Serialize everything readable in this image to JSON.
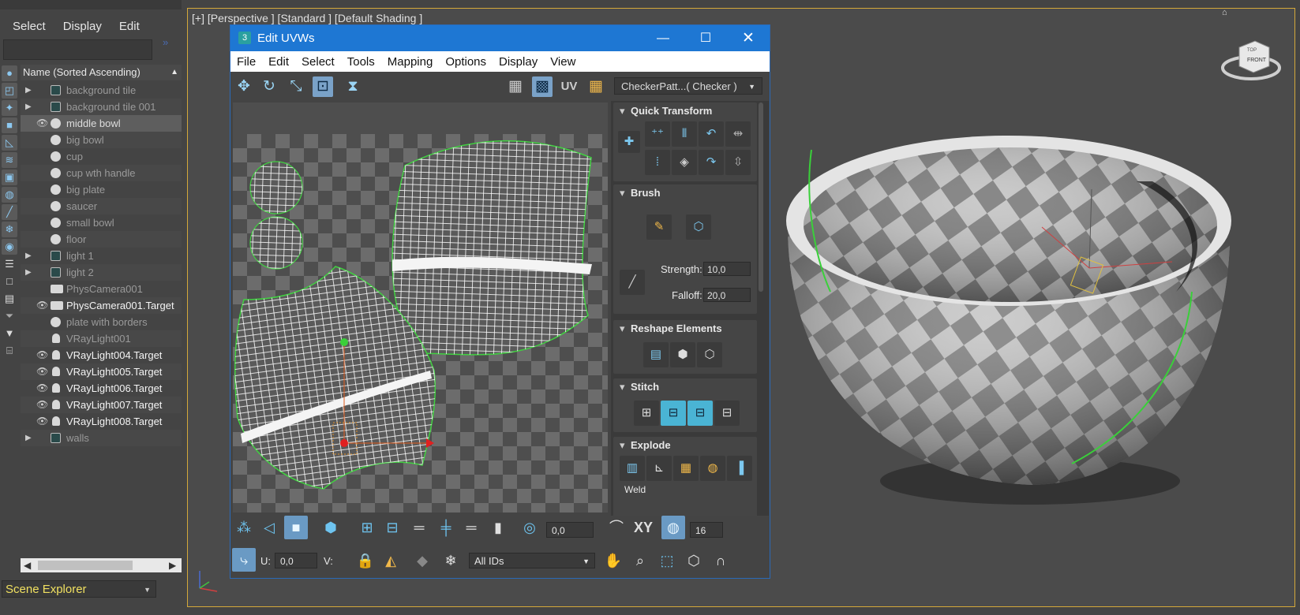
{
  "explorer": {
    "menu": [
      "Select",
      "Display",
      "Edit"
    ],
    "header": "Name (Sorted Ascending)",
    "footer": "Scene Explorer",
    "items": [
      {
        "label": "background tile",
        "exp": "▶",
        "eye": "",
        "icon": "sq",
        "style": "dim"
      },
      {
        "label": "background tile 001",
        "exp": "▶",
        "eye": "",
        "icon": "sq",
        "style": "dim"
      },
      {
        "label": "middle bowl",
        "exp": "",
        "eye": "👁",
        "icon": "circle",
        "style": "sel"
      },
      {
        "label": "big bowl",
        "exp": "",
        "eye": "",
        "icon": "circle",
        "style": "dim"
      },
      {
        "label": "cup",
        "exp": "",
        "eye": "",
        "icon": "circle",
        "style": "dim"
      },
      {
        "label": "cup wth handle",
        "exp": "",
        "eye": "",
        "icon": "circle",
        "style": "dim"
      },
      {
        "label": "big plate",
        "exp": "",
        "eye": "",
        "icon": "circle",
        "style": "dim"
      },
      {
        "label": "saucer",
        "exp": "",
        "eye": "",
        "icon": "circle",
        "style": "dim"
      },
      {
        "label": "small bowl",
        "exp": "",
        "eye": "",
        "icon": "circle",
        "style": "dim"
      },
      {
        "label": "floor",
        "exp": "",
        "eye": "",
        "icon": "circle",
        "style": "dim"
      },
      {
        "label": "light 1",
        "exp": "▶",
        "eye": "",
        "icon": "sq",
        "style": "dim"
      },
      {
        "label": "light 2",
        "exp": "▶",
        "eye": "",
        "icon": "sq",
        "style": "dim"
      },
      {
        "label": "PhysCamera001",
        "exp": "",
        "eye": "",
        "icon": "cam",
        "style": "dim"
      },
      {
        "label": "PhysCamera001.Target",
        "exp": "",
        "eye": "👁",
        "icon": "cam",
        "style": "bright"
      },
      {
        "label": "plate with borders",
        "exp": "",
        "eye": "",
        "icon": "circle",
        "style": "dim"
      },
      {
        "label": "VRayLight001",
        "exp": "",
        "eye": "",
        "icon": "bulb",
        "style": "dim"
      },
      {
        "label": "VRayLight004.Target",
        "exp": "",
        "eye": "👁",
        "icon": "bulb",
        "style": "bright"
      },
      {
        "label": "VRayLight005.Target",
        "exp": "",
        "eye": "👁",
        "icon": "bulb",
        "style": "bright"
      },
      {
        "label": "VRayLight006.Target",
        "exp": "",
        "eye": "👁",
        "icon": "bulb",
        "style": "bright"
      },
      {
        "label": "VRayLight007.Target",
        "exp": "",
        "eye": "👁",
        "icon": "bulb",
        "style": "bright"
      },
      {
        "label": "VRayLight008.Target",
        "exp": "",
        "eye": "👁",
        "icon": "bulb",
        "style": "bright"
      },
      {
        "label": "walls",
        "exp": "▶",
        "eye": "",
        "icon": "sq",
        "style": "dim"
      }
    ]
  },
  "viewport": {
    "label": "[+] [Perspective ] [Standard ] [Default Shading ]",
    "viewcube_top": "TOP",
    "viewcube_front": "FRONT"
  },
  "uvw": {
    "title": "Edit UVWs",
    "menu": [
      "File",
      "Edit",
      "Select",
      "Tools",
      "Mapping",
      "Options",
      "Display",
      "View"
    ],
    "uv_label": "UV",
    "checker": "CheckerPatt...( Checker )",
    "rollouts": {
      "quick_transform": "Quick Transform",
      "brush": "Brush",
      "strength_label": "Strength:",
      "strength_value": "10,0",
      "falloff_label": "Falloff:",
      "falloff_value": "20,0",
      "reshape": "Reshape Elements",
      "stitch": "Stitch",
      "explode": "Explode",
      "weld": "Weld"
    },
    "bottom": {
      "angle_value": "0,0",
      "xy_label": "XY",
      "grid_value": "16",
      "u_label": "U:",
      "u_value": "0,0",
      "v_label": "V:",
      "ids": "All IDs"
    }
  }
}
